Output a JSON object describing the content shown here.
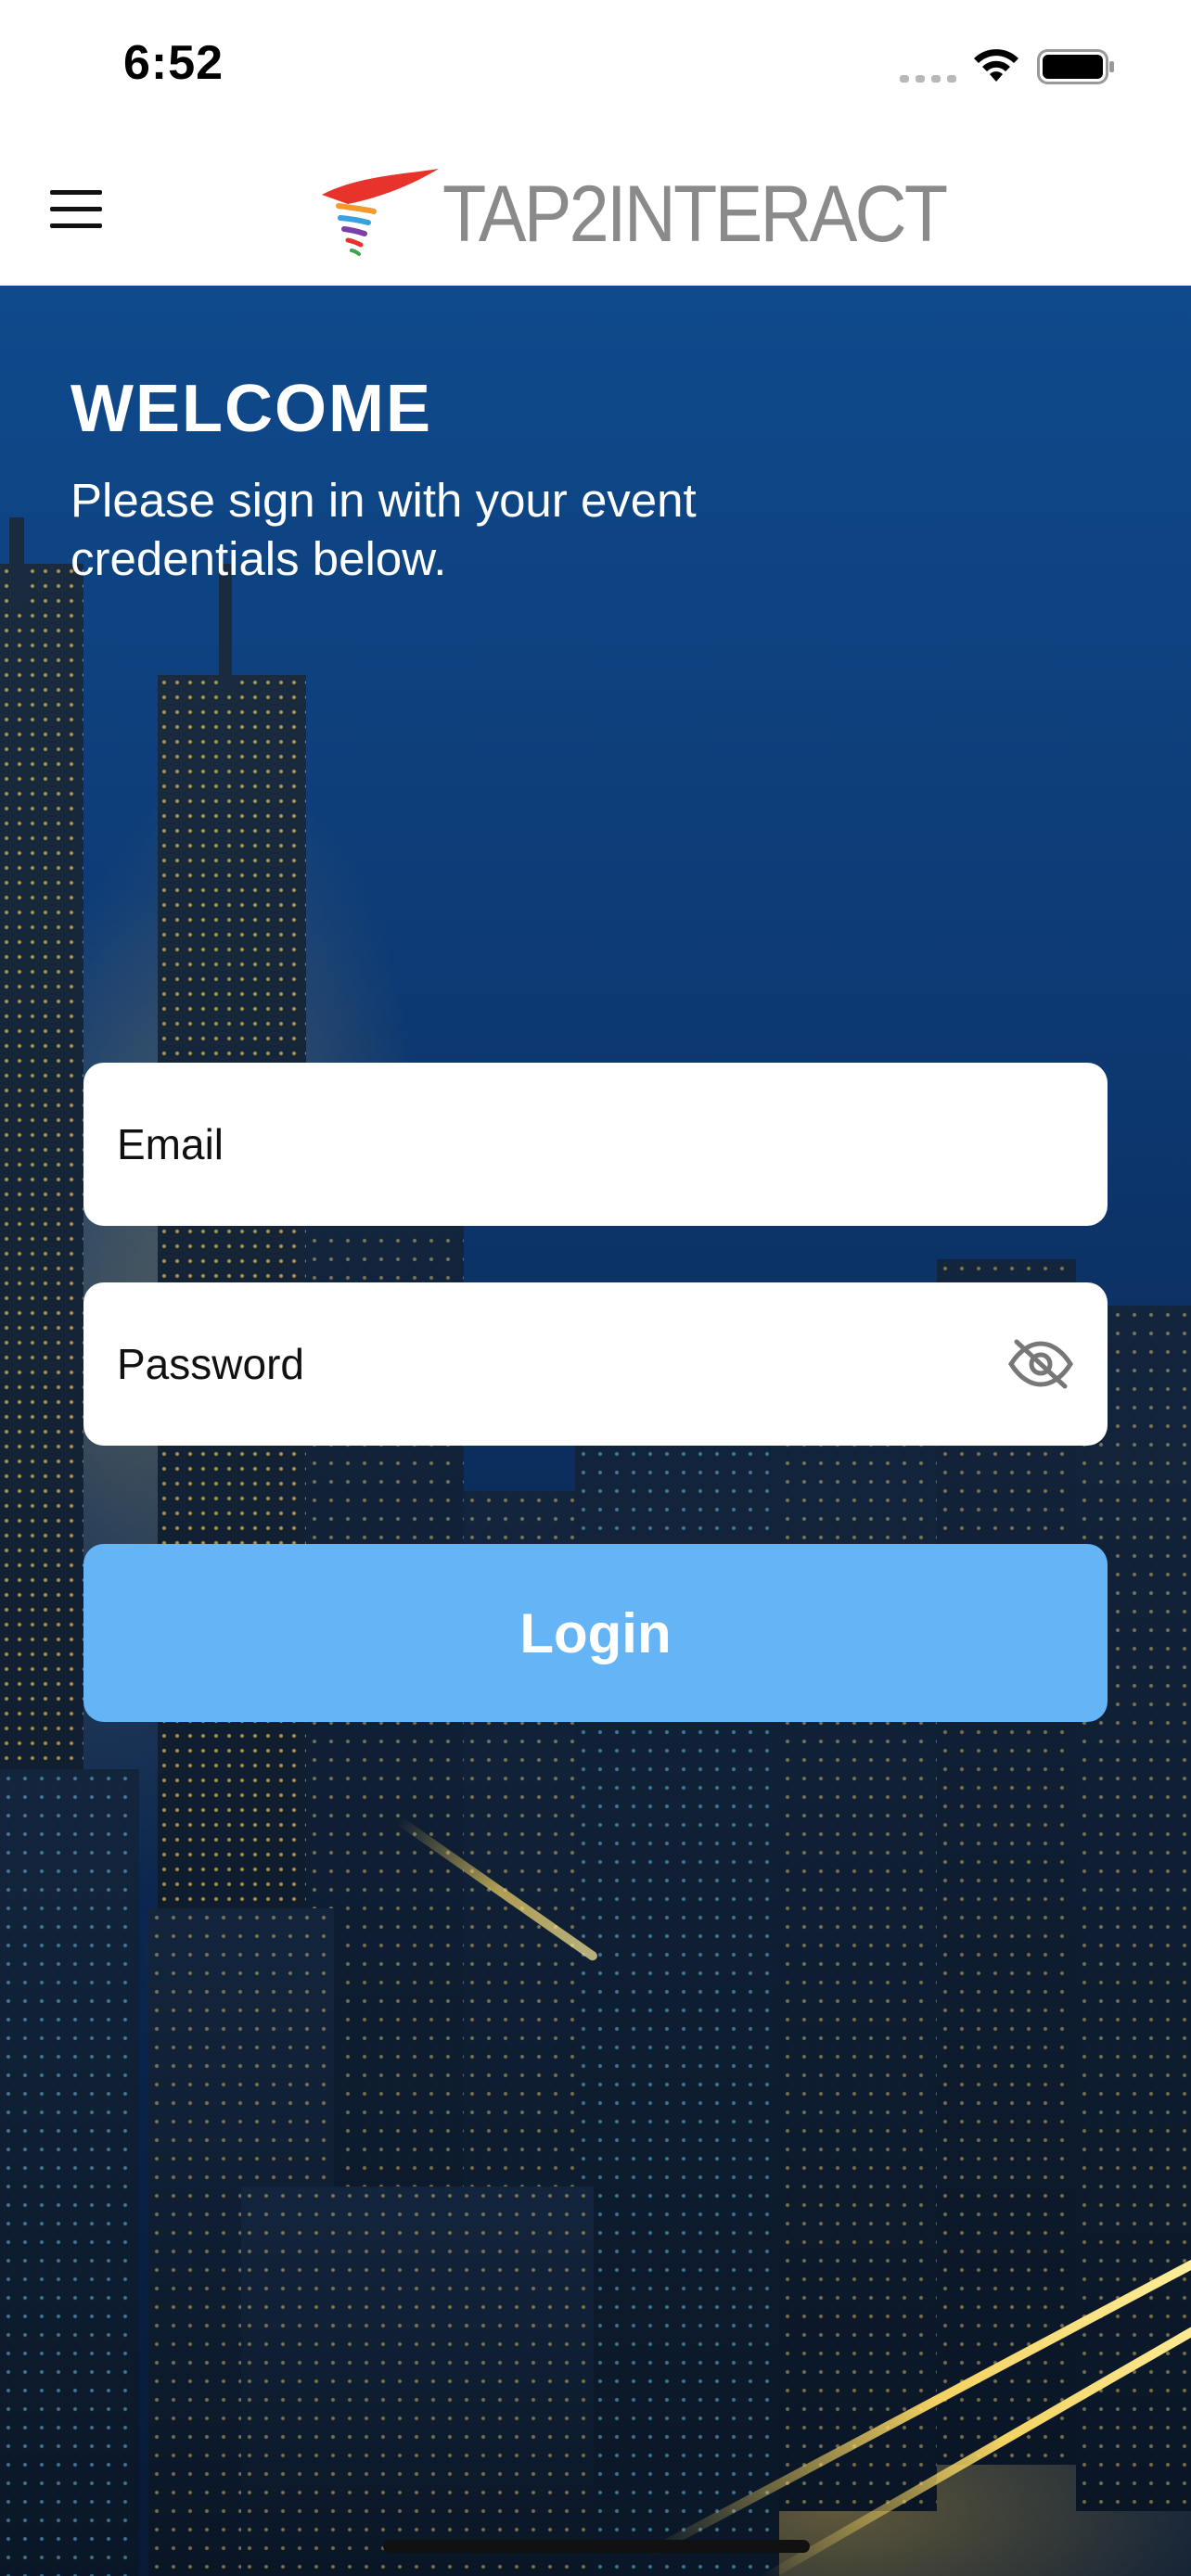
{
  "status_bar": {
    "time": "6:52",
    "icons": [
      "cellular-signal-icon",
      "wifi-icon",
      "battery-icon"
    ]
  },
  "nav": {
    "menu_icon": "hamburger-menu-icon",
    "logo_text": "TAP2INTERACT"
  },
  "hero": {
    "title": "WELCOME",
    "subtitle": "Please sign in with your event credentials below."
  },
  "form": {
    "email_placeholder": "Email",
    "password_placeholder": "Password",
    "password_toggle_icon": "eye-off-icon",
    "login_label": "Login"
  },
  "colors": {
    "login_button": "#64b4f6",
    "logo_text": "#8a8a8a",
    "logo_swoosh_red": "#e8332d"
  }
}
